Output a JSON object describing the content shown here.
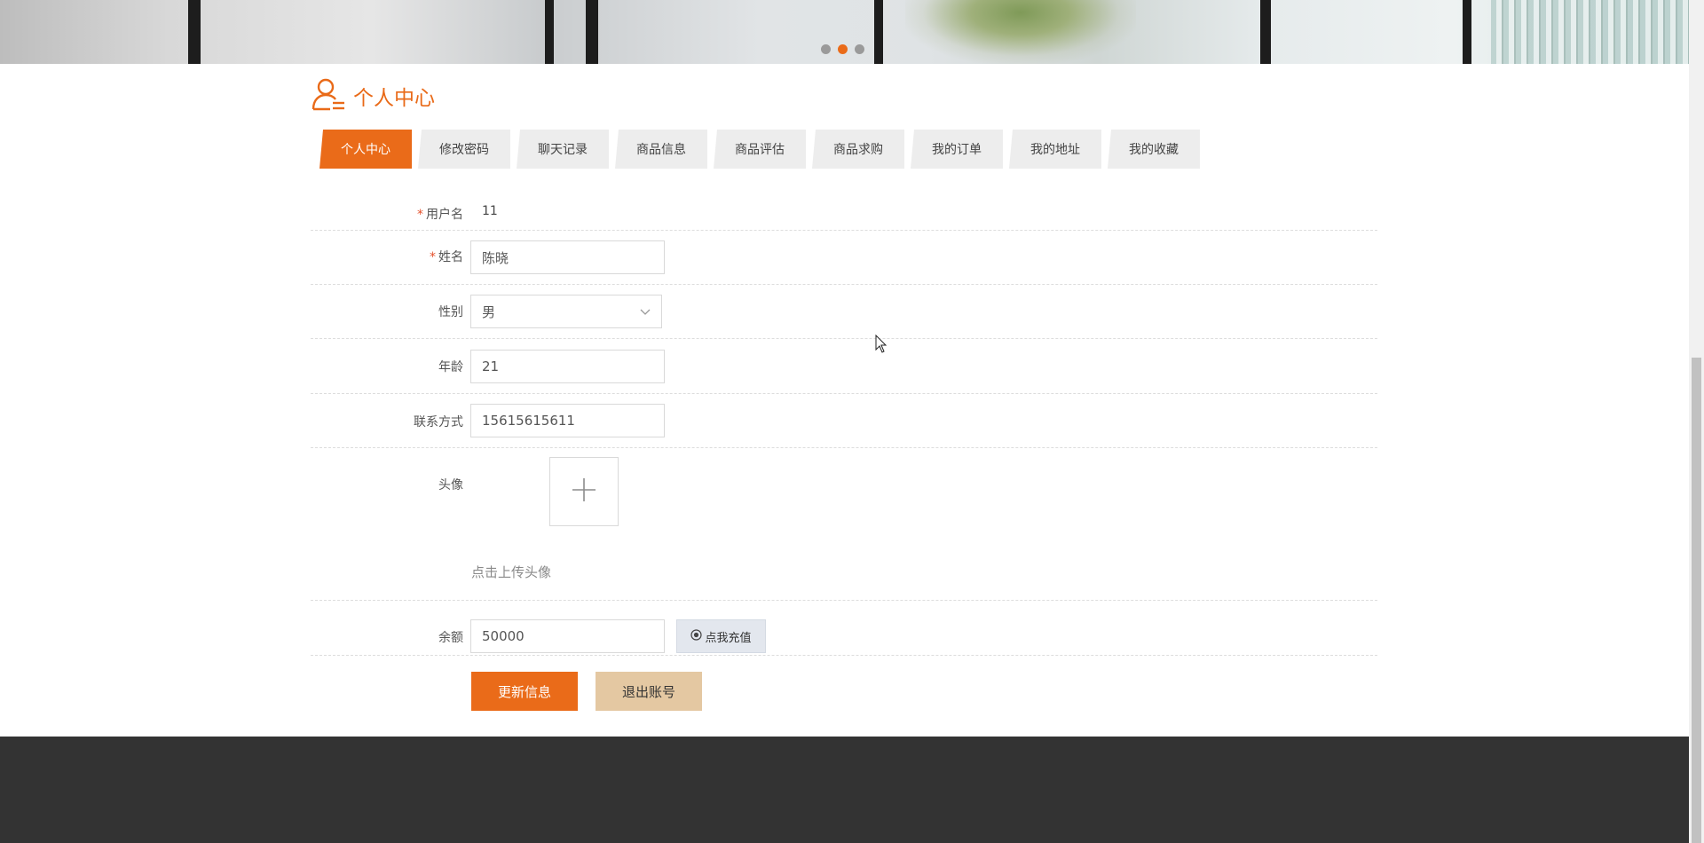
{
  "banner": {
    "slides": [
      {
        "active": false
      },
      {
        "active": true
      },
      {
        "active": false
      }
    ]
  },
  "section": {
    "title": "个人中心",
    "icon": "user-icon"
  },
  "tabs": [
    {
      "label": "个人中心",
      "active": true
    },
    {
      "label": "修改密码",
      "active": false
    },
    {
      "label": "聊天记录",
      "active": false
    },
    {
      "label": "商品信息",
      "active": false
    },
    {
      "label": "商品评估",
      "active": false
    },
    {
      "label": "商品求购",
      "active": false
    },
    {
      "label": "我的订单",
      "active": false
    },
    {
      "label": "我的地址",
      "active": false
    },
    {
      "label": "我的收藏",
      "active": false
    }
  ],
  "form": {
    "username": {
      "label": "用户名",
      "required": "*",
      "value": "11"
    },
    "name": {
      "label": "姓名",
      "required": "*",
      "value": "陈晓"
    },
    "gender": {
      "label": "性别",
      "value": "男"
    },
    "age": {
      "label": "年龄",
      "value": "21"
    },
    "phone": {
      "label": "联系方式",
      "value": "15615615611"
    },
    "avatar": {
      "label": "头像",
      "hint": "点击上传头像"
    },
    "balance": {
      "label": "余额",
      "value": "50000",
      "recharge_label": "点我充值"
    }
  },
  "actions": {
    "update_label": "更新信息",
    "logout_label": "退出账号"
  },
  "colors": {
    "accent": "#ea6b19",
    "logout": "#e4c8a2",
    "footer": "#333333"
  }
}
